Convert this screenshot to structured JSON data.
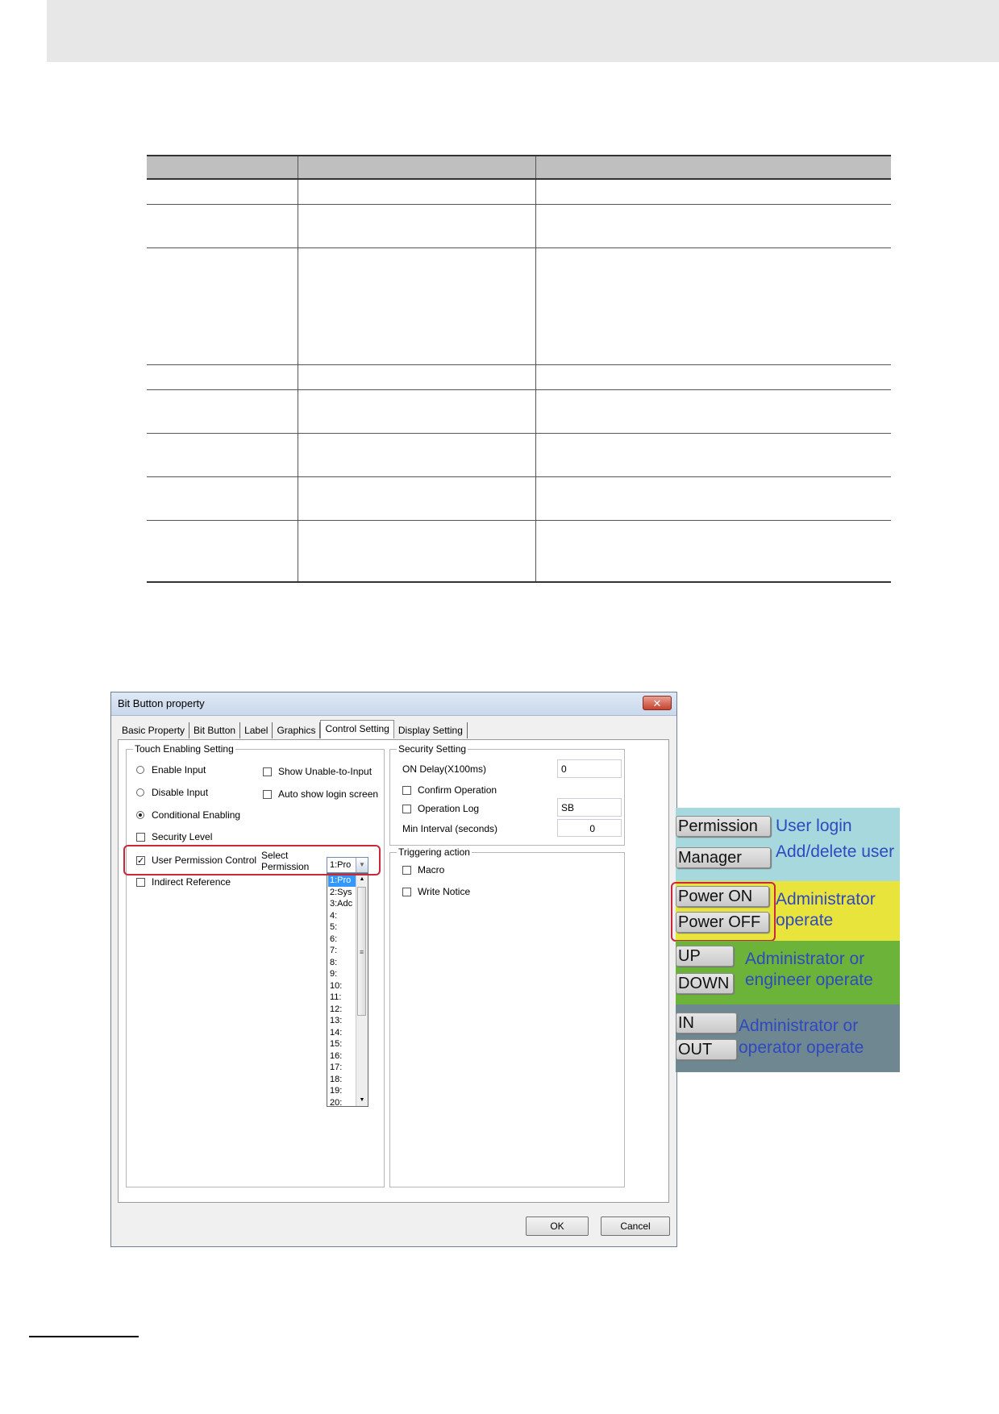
{
  "dialog": {
    "title": "Bit Button property",
    "close_glyph": "✕",
    "tabs": [
      "Basic Property",
      "Bit Button",
      "Label",
      "Graphics",
      "Control Setting",
      "Display Setting"
    ],
    "touch_group": {
      "title": "Touch Enabling Setting",
      "enable_input": "Enable Input",
      "disable_input": "Disable Input",
      "conditional_enabling": "Conditional Enabling",
      "security_level": "Security Level",
      "user_permission_control": "User Permission Control",
      "indirect_reference": "Indirect Reference",
      "show_unable": "Show Unable-to-Input",
      "auto_show_login": "Auto show login screen",
      "select_label": "Select",
      "permission_label": "Permission",
      "permission_value": "1:Pro",
      "permission_options": [
        "1:Pro",
        "2:Sys",
        "3:Adc",
        "4:",
        "5:",
        "6:",
        "7:",
        "8:",
        "9:",
        "10:",
        "11:",
        "12:",
        "13:",
        "14:",
        "15:",
        "16:",
        "17:",
        "18:",
        "19:",
        "20:"
      ],
      "check_mark": "✓"
    },
    "security_group": {
      "title": "Security Setting",
      "on_delay_label": "ON Delay(X100ms)",
      "on_delay_value": "0",
      "confirm_operation": "Confirm Operation",
      "operation_log": "Operation Log",
      "operation_log_value": "SB",
      "min_interval_label": "Min Interval (seconds)",
      "min_interval_value": "0"
    },
    "trigger_group": {
      "title": "Triggering action",
      "macro": "Macro",
      "write_notice": "Write Notice"
    },
    "ok_label": "OK",
    "cancel_label": "Cancel"
  },
  "panel": {
    "bands": [
      {
        "color": "#a6d8dd",
        "buttons": [
          "Permission",
          "Manager"
        ],
        "labels": [
          "User login",
          "Add/delete user"
        ]
      },
      {
        "color": "#e8e43c",
        "buttons": [
          "Power ON",
          "Power OFF"
        ],
        "labels": [
          "Administrator",
          "operate"
        ]
      },
      {
        "color": "#6cb33a",
        "buttons": [
          "UP",
          "DOWN"
        ],
        "labels": [
          "Administrator or",
          "engineer operate"
        ]
      },
      {
        "color": "#6e8791",
        "buttons": [
          "IN",
          "OUT"
        ],
        "labels": [
          "Administrator or",
          "operator operate"
        ]
      }
    ]
  }
}
